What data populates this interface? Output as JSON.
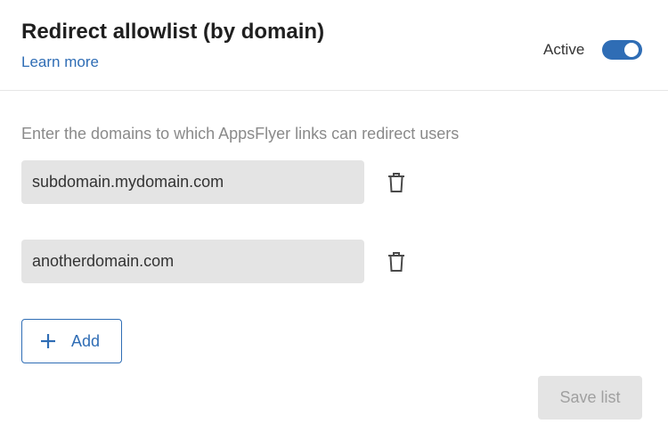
{
  "header": {
    "title": "Redirect allowlist (by domain)",
    "learn_more": "Learn more",
    "active_label": "Active",
    "active_toggle": {
      "on": true,
      "icon": "toggle-switch"
    }
  },
  "intro_text": "Enter the domains to which AppsFlyer links can redirect users",
  "domains": [
    {
      "value": "subdomain.mydomain.com",
      "delete_icon": "trash-icon"
    },
    {
      "value": "anotherdomain.com",
      "delete_icon": "trash-icon"
    }
  ],
  "add_button": {
    "label": "Add",
    "icon": "plus-icon"
  },
  "save_button": {
    "label": "Save list",
    "disabled": true
  },
  "colors": {
    "accent": "#2f6db5",
    "input_bg": "#e4e4e4",
    "muted_text": "#8a8a8a",
    "disabled_text": "#a0a0a0"
  }
}
